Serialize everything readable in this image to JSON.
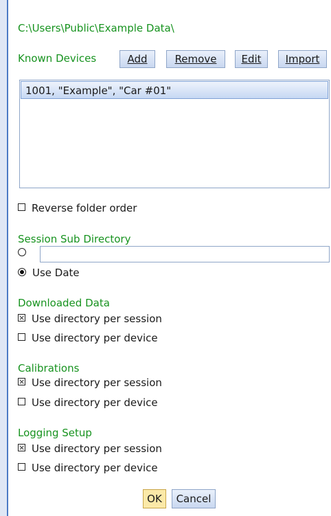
{
  "path": "C:\\Users\\Public\\Example Data\\",
  "known_devices": {
    "label": "Known Devices",
    "buttons": {
      "add": "Add",
      "remove": "Remove",
      "edit": "Edit",
      "import": "Import"
    },
    "items": [
      "1001, \"Example\", \"Car #01\""
    ]
  },
  "reverse_folder_order": {
    "label": "Reverse folder order",
    "checked": false
  },
  "session_sub_directory": {
    "heading": "Session Sub Directory",
    "custom_value": "",
    "use_date_label": "Use Date",
    "selected": "use_date"
  },
  "downloaded_data": {
    "heading": "Downloaded Data",
    "per_session": {
      "label": "Use directory per session",
      "checked": true
    },
    "per_device": {
      "label": "Use directory per device",
      "checked": false
    }
  },
  "calibrations": {
    "heading": "Calibrations",
    "per_session": {
      "label": "Use directory per session",
      "checked": true
    },
    "per_device": {
      "label": "Use directory per device",
      "checked": false
    }
  },
  "logging_setup": {
    "heading": "Logging Setup",
    "per_session": {
      "label": "Use directory per session",
      "checked": true
    },
    "per_device": {
      "label": "Use directory per device",
      "checked": false
    }
  },
  "footer": {
    "ok": "OK",
    "cancel": "Cancel"
  },
  "colors": {
    "section_heading": "#17931f",
    "ok_button": "#fbe9a8",
    "selection": "#c6d8f3"
  }
}
